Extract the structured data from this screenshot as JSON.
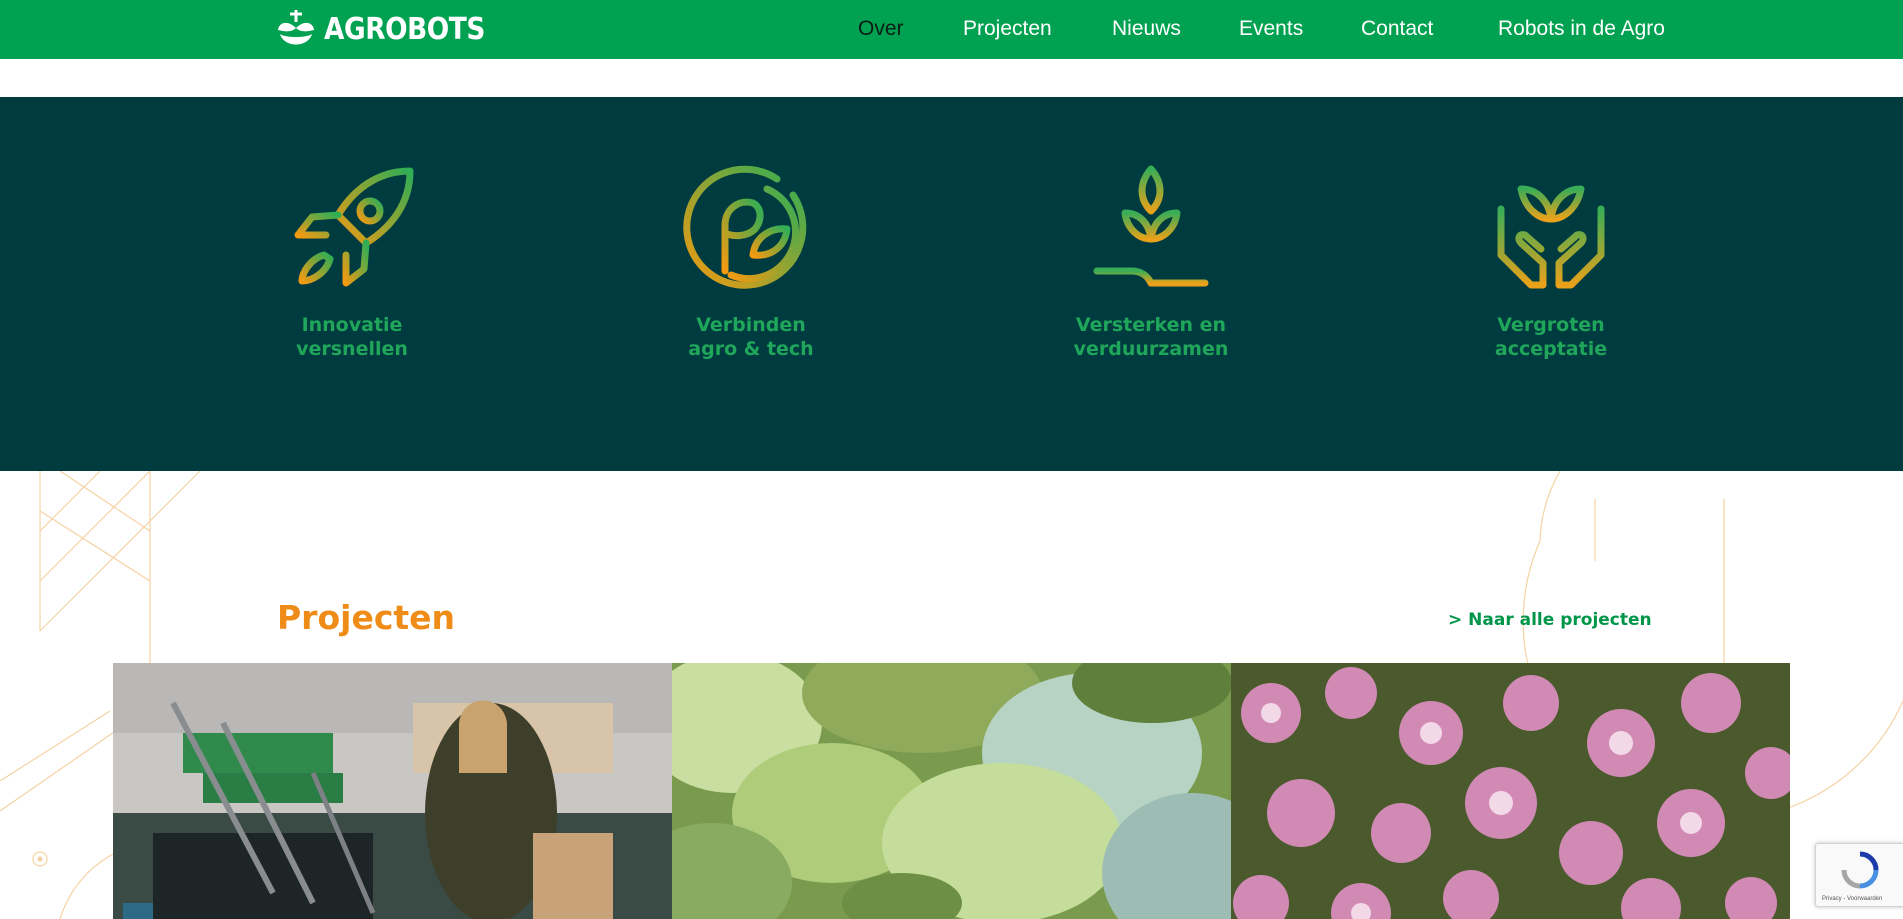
{
  "header": {
    "logo_text": "AGROBOTS",
    "nav": [
      {
        "label": "Over",
        "active": true
      },
      {
        "label": "Projecten",
        "active": false
      },
      {
        "label": "Nieuws",
        "active": false
      },
      {
        "label": "Events",
        "active": false
      },
      {
        "label": "Contact",
        "active": false
      },
      {
        "label": "Robots in de Agro",
        "active": false
      }
    ]
  },
  "features": [
    {
      "line1": "Innovatie",
      "line2": "versnellen",
      "icon": "rocket-icon"
    },
    {
      "line1": "Verbinden",
      "line2": "agro & tech",
      "icon": "leaf-circle-icon"
    },
    {
      "line1": "Versterken en",
      "line2": "verduurzamen",
      "icon": "plant-field-icon"
    },
    {
      "line1": "Vergroten",
      "line2": "acceptatie",
      "icon": "hands-plant-icon"
    }
  ],
  "projects": {
    "title": "Projecten",
    "all_link": "> Naar alle projecten",
    "cards": [
      {
        "image": "packing-line-worker-photo"
      },
      {
        "image": "cabbage-field-photo"
      },
      {
        "image": "pink-lilies-photo"
      }
    ]
  },
  "recaptcha": {
    "text": "Privacy - Voorwaarden"
  },
  "colors": {
    "brand_green": "#00a150",
    "dark_teal": "#003c3f",
    "accent_orange": "#ef8c17",
    "feature_green": "#1fa65a"
  }
}
